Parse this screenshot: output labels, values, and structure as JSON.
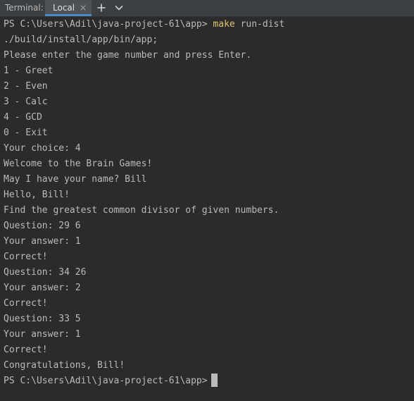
{
  "tabbar": {
    "title": "Terminal:",
    "tabs": [
      {
        "label": "Local"
      }
    ],
    "icons": {
      "close": "close-icon",
      "new_tab": "plus-icon",
      "dropdown": "chevron-down-icon"
    },
    "accent_color": "#4a88c7"
  },
  "terminal": {
    "prompt": "PS C:\\Users\\Adil\\java-project-61\\app>",
    "command": "make",
    "command_args": "run-dist",
    "command_color": "#e0c46c",
    "output": [
      "./build/install/app/bin/app;",
      "Please enter the game number and press Enter.",
      "1 - Greet",
      "2 - Even",
      "3 - Calc",
      "4 - GCD",
      "0 - Exit",
      "Your choice: 4",
      "Welcome to the Brain Games!",
      "May I have your name? Bill",
      "Hello, Bill!",
      "Find the greatest common divisor of given numbers.",
      "Question: 29 6",
      "Your answer: 1",
      "Correct!",
      "Question: 34 26",
      "Your answer: 2",
      "Correct!",
      "Question: 33 5",
      "Your answer: 1",
      "Correct!",
      "Congratulations, Bill!"
    ],
    "final_prompt": "PS C:\\Users\\Adil\\java-project-61\\app>"
  }
}
